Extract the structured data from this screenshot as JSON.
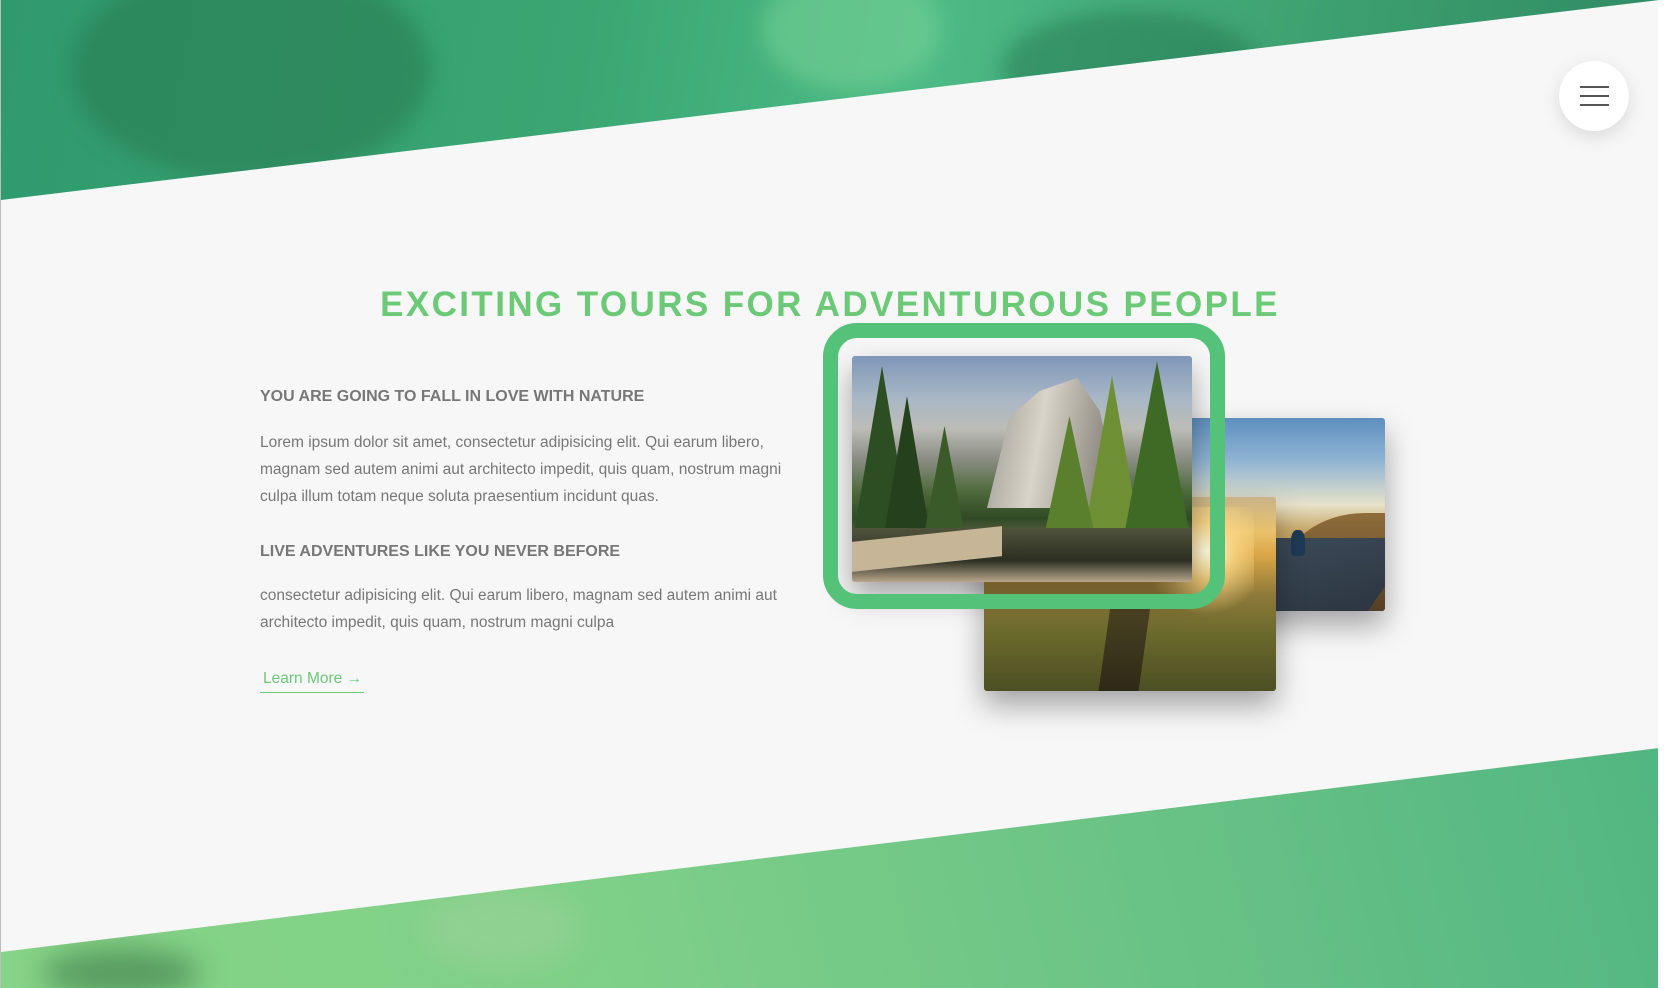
{
  "header": {
    "menu_icon": "hamburger-icon"
  },
  "section": {
    "title": "EXCITING TOURS FOR ADVENTUROUS PEOPLE",
    "heading_1": "YOU ARE GOING TO FALL IN LOVE WITH NATURE",
    "paragraph_1": "Lorem ipsum dolor sit amet, consectetur adipisicing elit. Qui earum libero, magnam sed autem animi aut architecto impedit, quis quam, nostrum magni culpa illum totam neque soluta praesentium incidunt quas.",
    "heading_2": "LIVE ADVENTURES LIKE YOU NEVER BEFORE",
    "paragraph_2": "consectetur adipisicing elit. Qui earum libero, magnam sed autem animi aut architecto impedit, quis quam, nostrum magni culpa",
    "link_label": "Learn More →"
  },
  "colors": {
    "accent": "#6cc977",
    "highlight_frame": "#55c27a",
    "band_top": "#3aa773",
    "band_bottom": "#7fd088",
    "background": "#f7f7f7",
    "body_text": "#777777"
  }
}
